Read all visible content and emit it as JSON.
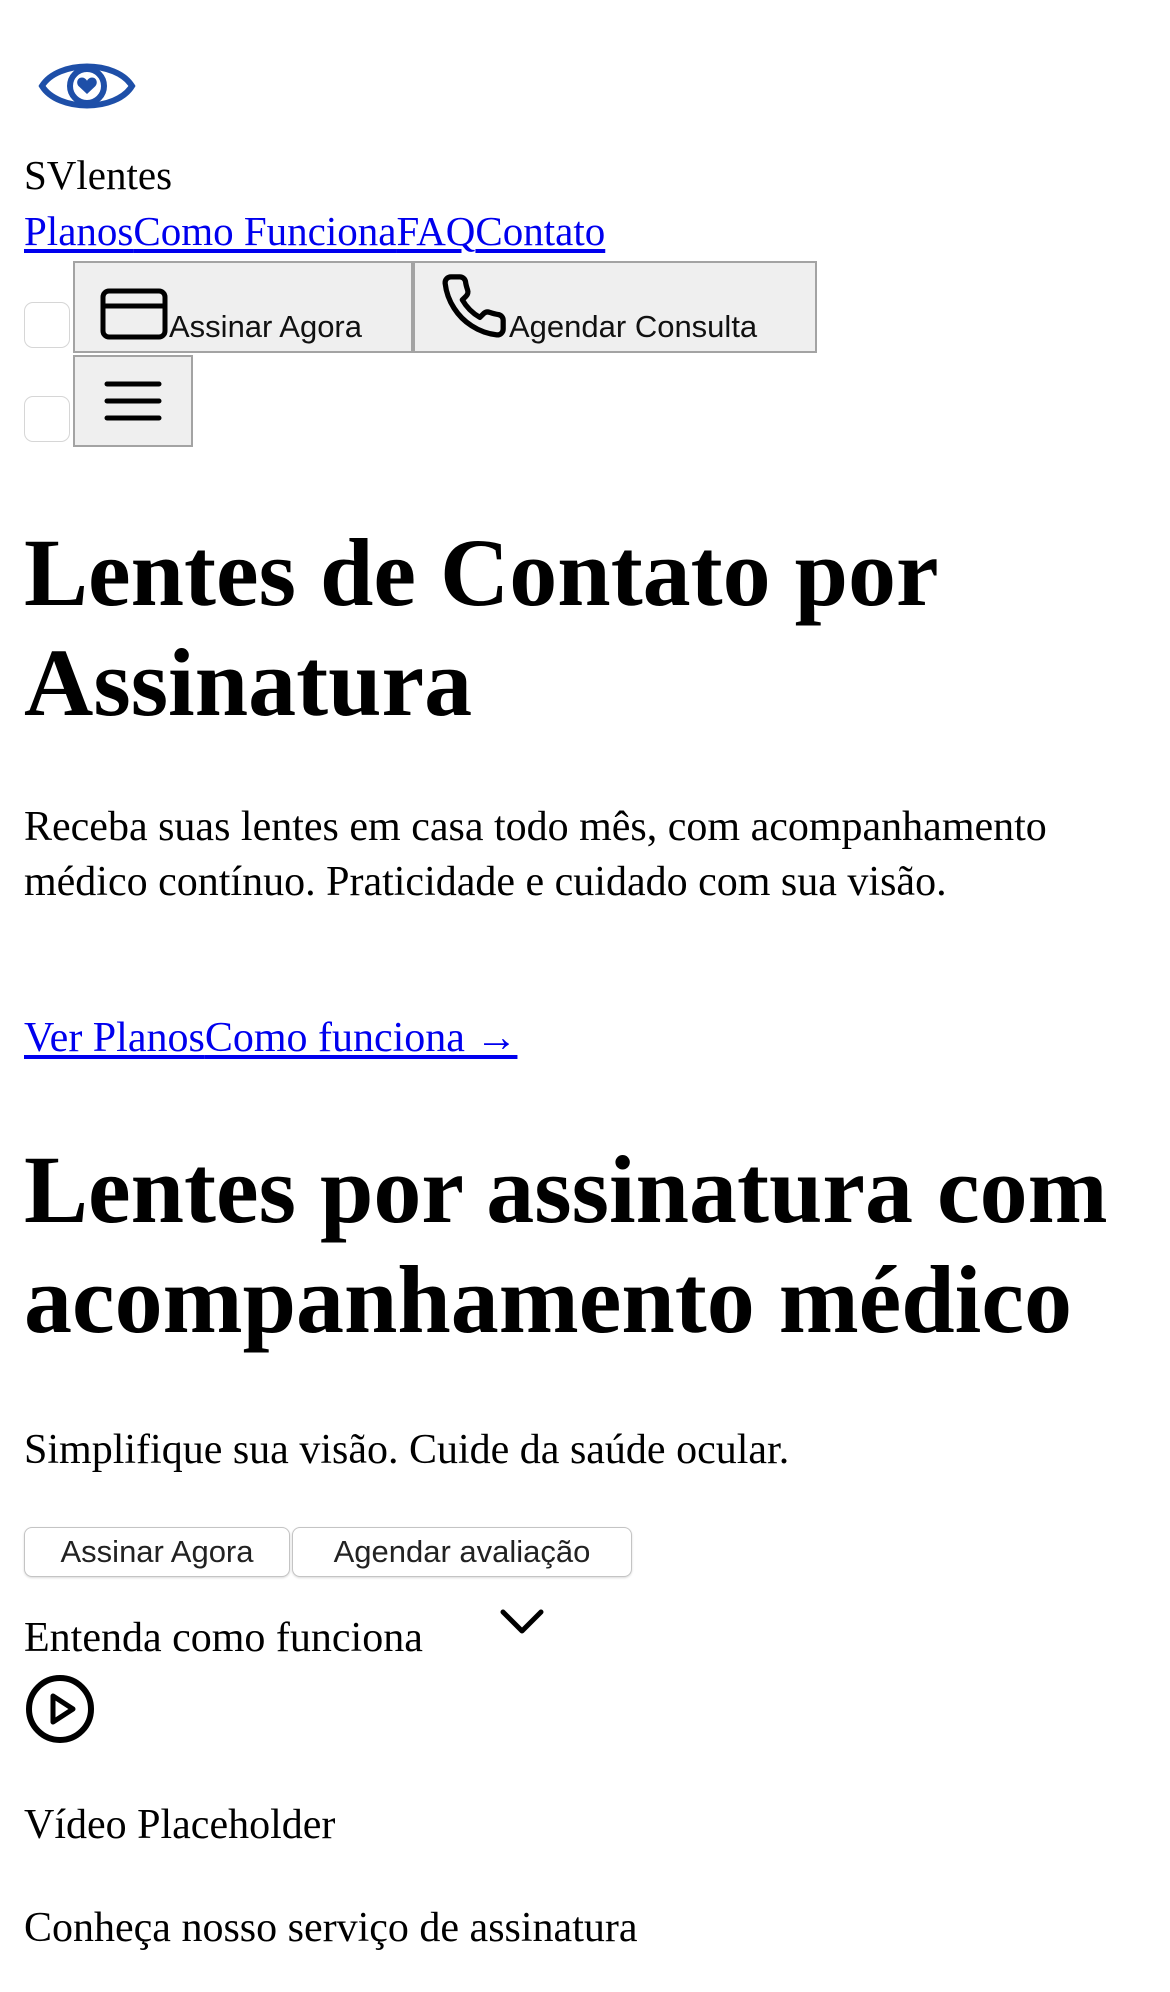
{
  "brand": {
    "name": "SVlentes",
    "accent_color": "#1e4fa8",
    "logo_icon": "eye-heart-icon"
  },
  "nav": {
    "items": [
      "Planos",
      "Como Funciona",
      "FAQ",
      "Contato"
    ]
  },
  "header_actions": {
    "subscribe_label": "Assinar Agora",
    "subscribe_icon": "credit-card-icon",
    "schedule_label": "Agendar Consulta",
    "schedule_icon": "phone-icon",
    "menu_icon": "hamburger-menu-icon"
  },
  "hero": {
    "title": "Lentes de Contato por Assinatura",
    "lead": "Receba suas lentes em casa todo mês, com acompanhamento médico contínuo. Praticidade e cuidado com sua visão.",
    "link_plans": "Ver Planos",
    "link_how": "Como funciona →"
  },
  "section": {
    "title": "Lentes por assinatura com acompanhamento médico",
    "subtitle": "Simplifique sua visão. Cuide da saúde ocular.",
    "button_subscribe": "Assinar Agora",
    "button_evaluate": "Agendar avaliação",
    "expand_label": "Entenda como funciona",
    "video_placeholder": "Vídeo Placeholder",
    "video_caption": "Conheça nosso serviço de assinatura"
  }
}
